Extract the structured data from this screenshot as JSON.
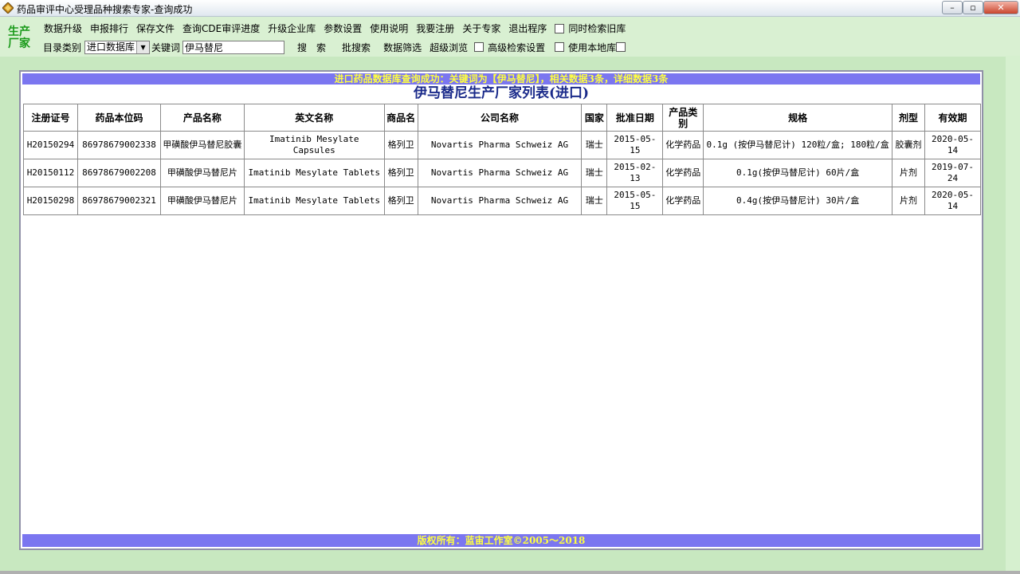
{
  "window": {
    "title": "药品审评中心受理品种搜索专家-查询成功",
    "minimize_symbol": "–",
    "maximize_symbol": "▫",
    "close_symbol": "✕"
  },
  "logo": {
    "line1": "生产",
    "line2": "厂家"
  },
  "menu": [
    "数据升级",
    "申报排行",
    "保存文件",
    "查询CDE审评进度",
    "升级企业库",
    "参数设置",
    "使用说明",
    "我要注册",
    "关于专家",
    "退出程序"
  ],
  "menu_checkbox": {
    "label": "同时检索旧库",
    "checked": false
  },
  "row2": {
    "catalog_label": "目录类别",
    "catalog_value": "进口数据库",
    "keyword_label": "关键词",
    "keyword_value": "伊马替尼",
    "search_label": "搜　索",
    "batch_search_label": "批搜索",
    "filter_label": "数据筛选",
    "super_browse_label": "超级浏览",
    "advanced_label": "高级检索设置",
    "local_label": "使用本地库"
  },
  "banner": "进口药品数据库查询成功：关键词为【伊马替尼】，相关数据3条，详细数据3条",
  "list_title": "伊马替尼生产厂家列表(进口)",
  "table": {
    "headers": [
      "注册证号",
      "药品本位码",
      "产品名称",
      "英文名称",
      "商品名",
      "公司名称",
      "国家",
      "批准日期",
      "产品类别",
      "规格",
      "剂型",
      "有效期"
    ],
    "rows": [
      [
        "H20150294",
        "86978679002338",
        "甲磺酸伊马替尼胶囊",
        "Imatinib Mesylate Capsules",
        "格列卫",
        "Novartis Pharma Schweiz AG",
        "瑞士",
        "2015-05-15",
        "化学药品",
        "0.1g (按伊马替尼计) 120粒/盒; 180粒/盒",
        "胶囊剂",
        "2020-05-14"
      ],
      [
        "H20150112",
        "86978679002208",
        "甲磺酸伊马替尼片",
        "Imatinib Mesylate Tablets",
        "格列卫",
        "Novartis Pharma Schweiz AG",
        "瑞士",
        "2015-02-13",
        "化学药品",
        "0.1g(按伊马替尼计) 60片/盒",
        "片剂",
        "2019-07-24"
      ],
      [
        "H20150298",
        "86978679002321",
        "甲磺酸伊马替尼片",
        "Imatinib Mesylate Tablets",
        "格列卫",
        "Novartis Pharma Schweiz AG",
        "瑞士",
        "2015-05-15",
        "化学药品",
        "0.4g(按伊马替尼计) 30片/盒",
        "片剂",
        "2020-05-14"
      ]
    ]
  },
  "footer": "版权所有：蓝宙工作室©2005～2018",
  "colors": {
    "banner_bg": "#7b76f0",
    "banner_text": "#ffff40",
    "title_text": "#1a2a8a",
    "page_bg": "#c8e8c0"
  }
}
